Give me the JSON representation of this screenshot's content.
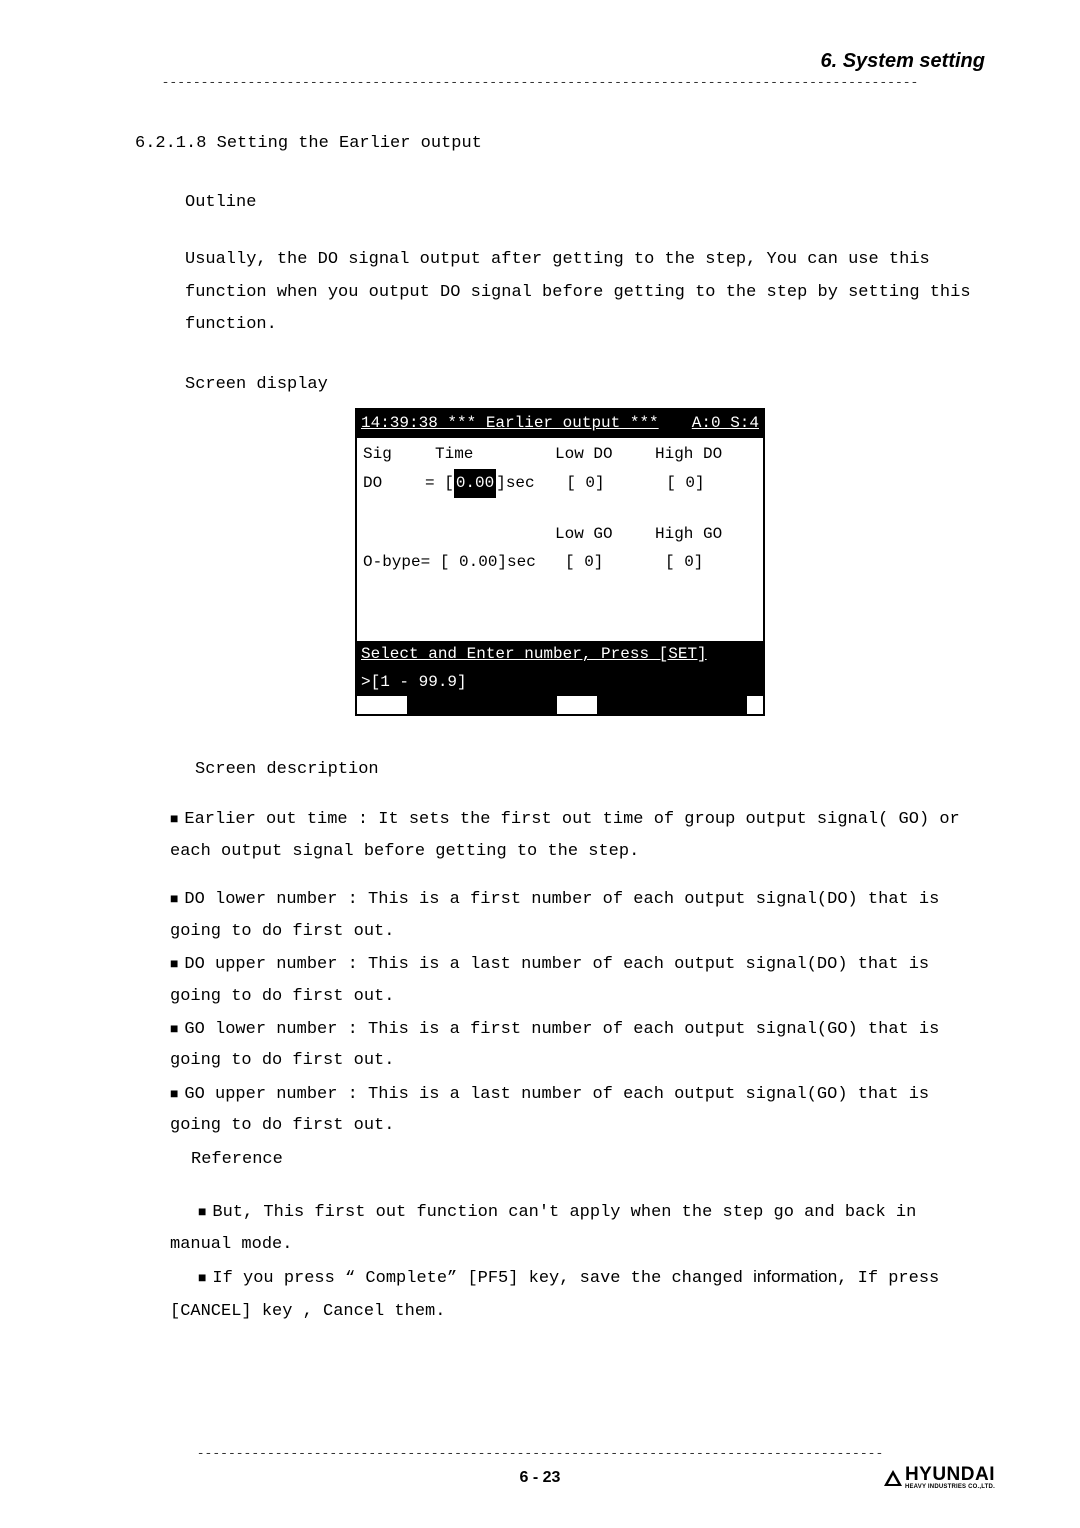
{
  "header": {
    "title": "6. System setting"
  },
  "section": {
    "number": "6.2.1.8 Setting the Earlier output",
    "outline_label": "Outline",
    "outline_text": "Usually, the DO signal output after getting to the step, You can use this function when you output DO signal before getting to the step by setting this function.",
    "screen_display_label": "Screen display"
  },
  "screen": {
    "header_left": "14:39:38 *** Earlier output ***",
    "header_right": "A:0 S:4",
    "row1_sig": "Sig",
    "row1_time": "Time",
    "row1_low": "Low DO",
    "row1_high": "High DO",
    "row2_do": "DO",
    "row2_eq": "= [",
    "row2_val": " 0.00",
    "row2_sec": "]sec",
    "row2_low_val": "[  0]",
    "row2_high_val": "[  0]",
    "row3_low": "Low GO",
    "row3_high": "High GO",
    "row4_left": "O-bype= [ 0.00]sec",
    "row4_low_val": "[  0]",
    "row4_high_val": "[  0]",
    "footer1": "Select and Enter number, Press [SET]",
    "footer2": ">[1 - 99.9]"
  },
  "description": {
    "label": "Screen description",
    "items": [
      {
        "title": "Earlier out time :",
        "text": "It sets the first out time of group output signal( GO) or each output signal before getting to the step."
      },
      {
        "title": "DO lower number :",
        "text": "This is a first number of each output signal(DO) that is going to do first out."
      },
      {
        "title": "DO upper number :",
        "text": "This is a last number of each output signal(DO) that is going to do first out."
      },
      {
        "title": "GO lower number :",
        "text": " This is a first number of each output signal(GO) that is going to do first out."
      },
      {
        "title": "GO upper number :",
        "text": "This is a last number of each output signal(GO) that is going to do first out."
      }
    ],
    "reference_label": "Reference",
    "ref1": "But, This first out function can't apply when the step go and back in manual mode.",
    "ref2_a": "If you press “ Complete” [PF5] key, save the changed ",
    "ref2_b": "information",
    "ref2_c": ", If press [CANCEL] key , Cancel them."
  },
  "footer": {
    "page": "6 - 23",
    "logo": "HYUNDAI",
    "logo_sub": "HEAVY INDUSTRIES CO.,LTD."
  }
}
